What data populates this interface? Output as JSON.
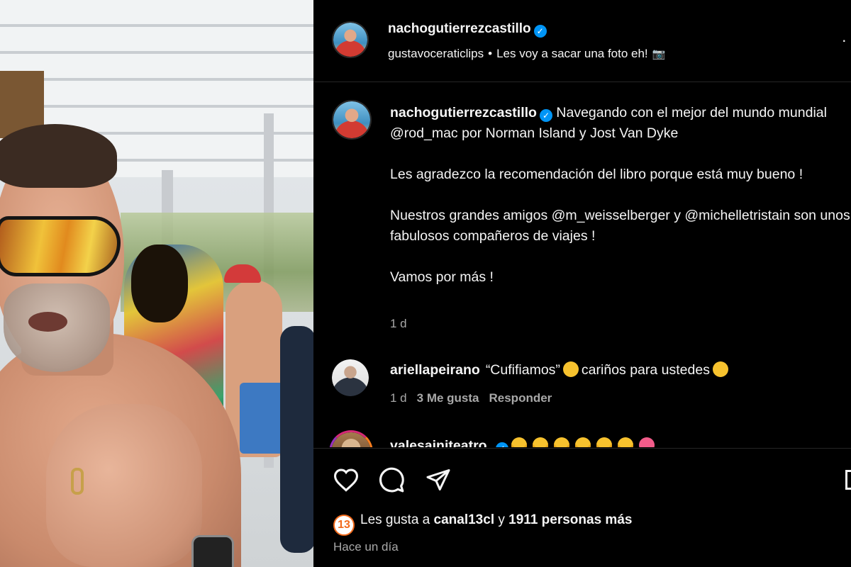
{
  "post": {
    "author": "nachogutierrezcastillo",
    "audio_author": "gustavoceraticlips",
    "separator": "•",
    "audio_title": "Les voy a sacar una foto eh!",
    "camera_emoji": "📷",
    "more_icon": "more-dots-icon"
  },
  "caption": {
    "username": "nachogutierrezcastillo",
    "paragraphs": [
      "Navegando con el mejor del mundo mundial @rod_mac por Norman Island y Jost Van Dyke",
      "Les agradezco la recomendación del libro porque está muy bueno !",
      "Nuestros grandes amigos @m_weisselberger y @michelletristain son unos fabulosos compañeros de viajes !",
      "Vamos por más !"
    ],
    "time": "1 d"
  },
  "comments": [
    {
      "username": "ariellapeirano",
      "text_before": "“Cufifiamos”",
      "text_after": "cariños para ustedes",
      "time": "1 d",
      "likes": "3 Me gusta",
      "reply_label": "Responder"
    },
    {
      "username": "valesainiteatro"
    }
  ],
  "actions": {
    "liker_badge": "13",
    "likes_prefix": "Les gusta a",
    "liker": "canal13cl",
    "likes_joiner": "y",
    "likes_count": "1911 personas más",
    "posted": "Hace un día"
  },
  "colors": {
    "verified": "#0095f6",
    "secondary_text": "#a8a8a8",
    "background": "#000000"
  }
}
